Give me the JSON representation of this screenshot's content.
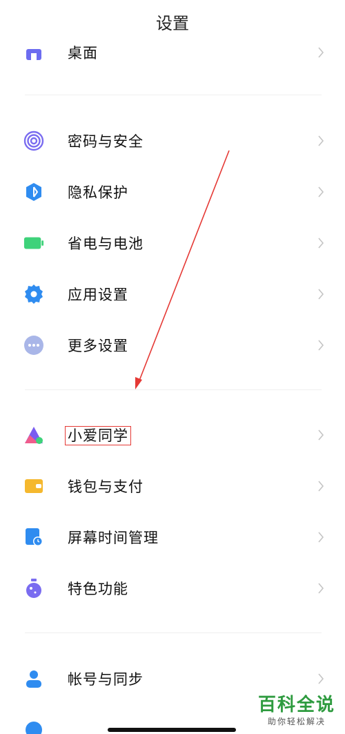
{
  "header": {
    "title": "设置"
  },
  "rows": [
    {
      "label": "桌面",
      "icon": "desktop-icon",
      "color": "#6c6cf0"
    },
    {
      "label": "密码与安全",
      "icon": "fingerprint-icon",
      "color": "#7a6cf0"
    },
    {
      "label": "隐私保护",
      "icon": "privacy-shield-icon",
      "color": "#2f8cf0"
    },
    {
      "label": "省电与电池",
      "icon": "battery-icon",
      "color": "#3ed27a"
    },
    {
      "label": "应用设置",
      "icon": "gear-icon",
      "color": "#2f8cf0"
    },
    {
      "label": "更多设置",
      "icon": "more-dots-icon",
      "color": "#a9b6e8"
    },
    {
      "label": "小爱同学",
      "icon": "xiaoai-icon",
      "color": "#7a5cf0",
      "highlighted": true
    },
    {
      "label": "钱包与支付",
      "icon": "wallet-icon",
      "color": "#f5b82e"
    },
    {
      "label": "屏幕时间管理",
      "icon": "screen-time-icon",
      "color": "#2f8cf0"
    },
    {
      "label": "特色功能",
      "icon": "feature-flask-icon",
      "color": "#7a6cf0"
    },
    {
      "label": "帐号与同步",
      "icon": "account-icon",
      "color": "#2f8cf0"
    }
  ],
  "watermark": {
    "title": "百科全说",
    "subtitle": "助你轻松解决"
  },
  "colors": {
    "annotation": "#e53935",
    "chevron": "#c4c4c4"
  }
}
